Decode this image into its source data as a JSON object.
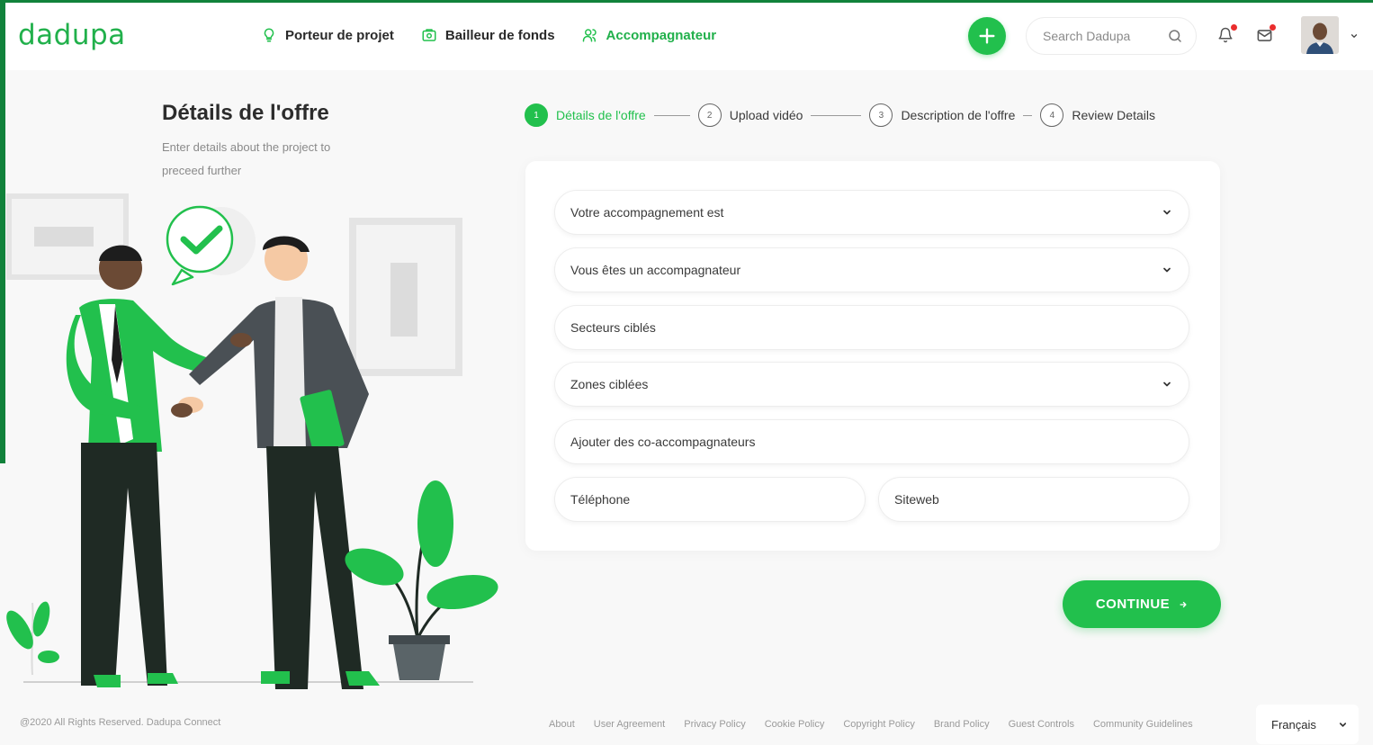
{
  "header": {
    "logo": "dadupa",
    "nav": [
      {
        "label": "Porteur de projet",
        "icon": "lightbulb-icon",
        "active": false
      },
      {
        "label": "Bailleur de fonds",
        "icon": "money-icon",
        "active": false
      },
      {
        "label": "Accompagnateur",
        "icon": "users-icon",
        "active": true
      }
    ],
    "search_placeholder": "Search Dadupa"
  },
  "page": {
    "title": "Détails de l'offre",
    "subtitle": "Enter details about the project to preceed further"
  },
  "stepper": [
    {
      "number": "1",
      "label": "Détails de l'offre",
      "active": true
    },
    {
      "number": "2",
      "label": "Upload vidéo",
      "active": false
    },
    {
      "number": "3",
      "label": "Description de l'offre",
      "active": false
    },
    {
      "number": "4",
      "label": "Review Details",
      "active": false
    }
  ],
  "form": {
    "accompagnement": "Votre accompagnement est",
    "type_accompagnateur": "Vous êtes un accompagnateur",
    "secteurs": "Secteurs ciblés",
    "zones": "Zones ciblées",
    "co_accompagnateurs": "Ajouter des co-accompagnateurs",
    "telephone": "Téléphone",
    "siteweb": "Siteweb"
  },
  "continue_label": "CONTINUE",
  "footer": {
    "copyright": "@2020 All Rights Reserved. Dadupa Connect",
    "links": [
      "About",
      "User Agreement",
      "Privacy Policy",
      "Cookie Policy",
      "Copyright Policy",
      "Brand Policy",
      "Guest Controls",
      "Community Guidelines"
    ],
    "language": "Français"
  },
  "colors": {
    "accent": "#22c04d",
    "border_dark": "#11823b",
    "notification": "#ea2d2d"
  }
}
